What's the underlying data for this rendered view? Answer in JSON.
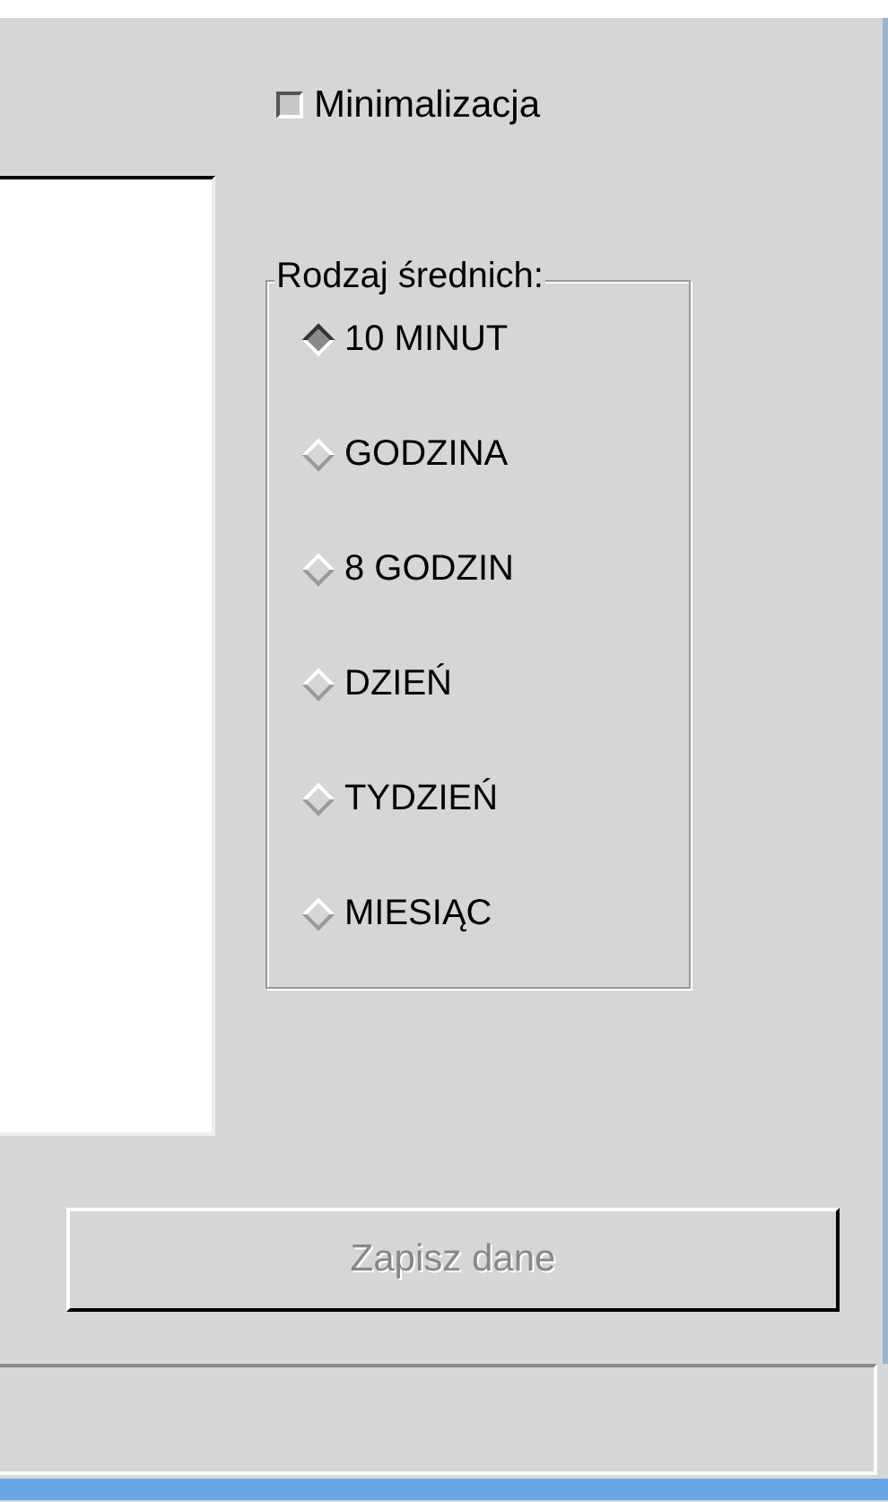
{
  "minimize_checkbox": {
    "label": "Minimalizacja",
    "checked": false
  },
  "averages_group": {
    "title": "Rodzaj średnich:",
    "options": [
      {
        "label": "10 MINUT",
        "selected": true
      },
      {
        "label": "GODZINA",
        "selected": false
      },
      {
        "label": "8 GODZIN",
        "selected": false
      },
      {
        "label": "DZIEŃ",
        "selected": false
      },
      {
        "label": "TYDZIEŃ",
        "selected": false
      },
      {
        "label": "MIESIĄC",
        "selected": false
      }
    ]
  },
  "save_button": {
    "label": "Zapisz dane",
    "disabled": true
  }
}
